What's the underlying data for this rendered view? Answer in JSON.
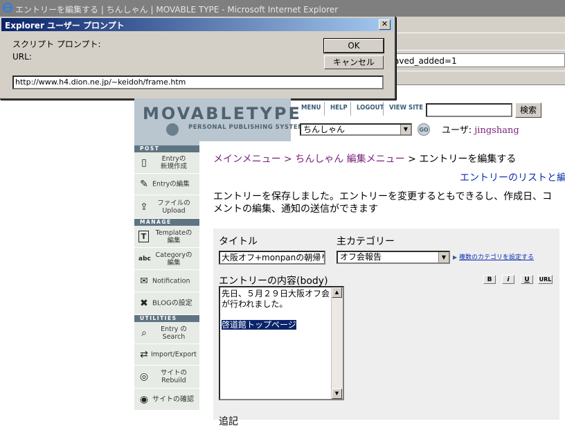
{
  "browser": {
    "window_title": "エントリーを編集する | ちんしゃん | MOVABLE TYPE - Microsoft Internet Explorer",
    "address_fragment": "aved_added=1"
  },
  "prompt": {
    "title": "Explorer ユーザー プロンプト",
    "close_glyph": "✕",
    "script_prompt_label": "スクリプト プロンプト:",
    "url_label": "URL:",
    "ok_label": "OK",
    "cancel_label": "キャンセル",
    "input_value": "http://www.h4.dion.ne.jp/~keidoh/frame.htm"
  },
  "mt": {
    "logo_brand": "MOVABLETYPE",
    "logo_sub": "PERSONAL PUBLISHING SYSTEM",
    "nav": [
      "MENU",
      "HELP",
      "LOGOUT",
      "VIEW SITE"
    ],
    "search_button": "検索",
    "blog_select_value": "ちんしゃん",
    "go_label": "GO",
    "user_label": "ユーザ:",
    "user_name": "jingshang"
  },
  "sidebar": {
    "sections": [
      "POST",
      "MANAGE",
      "UTILITIES"
    ],
    "items": [
      {
        "icon": "new-entry-icon",
        "line1": "Entryの",
        "line2": "新規作成"
      },
      {
        "icon": "edit-entry-icon",
        "line1": "Entryの編集",
        "line2": ""
      },
      {
        "icon": "upload-icon",
        "line1": "ファイルの",
        "line2": "Upload"
      },
      {
        "icon": "template-icon",
        "line1": "Templateの",
        "line2": "編集"
      },
      {
        "icon": "category-icon",
        "line1": "Categoryの",
        "line2": "編集"
      },
      {
        "icon": "notification-icon",
        "line1": "Notification",
        "line2": ""
      },
      {
        "icon": "tools-icon",
        "line1": "BLOGの設定",
        "line2": ""
      },
      {
        "icon": "search-icon",
        "line1": "Entry の",
        "line2": "Search"
      },
      {
        "icon": "import-export-icon",
        "line1": "Import/Export",
        "line2": ""
      },
      {
        "icon": "rebuild-icon",
        "line1": "サイトの",
        "line2": "Rebuild"
      },
      {
        "icon": "view-site-icon",
        "line1": "サイトの確認",
        "line2": ""
      }
    ]
  },
  "main": {
    "breadcrumb": {
      "main_menu": "メインメニュー",
      "sep": " > ",
      "blog_menu": "ちんしゃん 編集メニュー",
      "current": "エントリーを編集する"
    },
    "list_link": "エントリーのリストと編集",
    "message": "エントリーを保存しました。エントリーを変更するともできるし、作成日、コメントの編集、通知の送信ができます",
    "title_label": "タイトル",
    "title_value": "大阪オフ+monpanの朝帰り+",
    "category_label": "主カテゴリー",
    "category_value": "オフ会報告",
    "multi_category_link": "複数のカテゴリを設定する",
    "body_label": "エントリーの内容(body)",
    "format_buttons": [
      "B",
      "i",
      "U",
      "URL"
    ],
    "body_text": "先日、５月２９日大阪オフ会が行われました。",
    "body_selected": "啓道館トップページ",
    "next_label": "追記"
  }
}
